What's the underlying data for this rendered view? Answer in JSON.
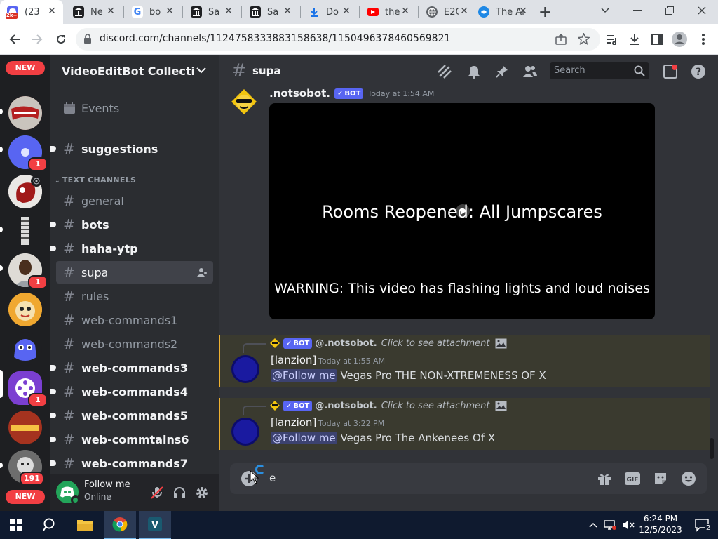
{
  "browser": {
    "tabs": [
      {
        "icon": "discord-icon",
        "title": "(23",
        "badge": "2k+",
        "active": true
      },
      {
        "icon": "museum-icon",
        "title": "Ne"
      },
      {
        "icon": "google-icon",
        "title": "bo"
      },
      {
        "icon": "museum-icon",
        "title": "Sa"
      },
      {
        "icon": "museum-icon",
        "title": "Sa"
      },
      {
        "icon": "download-icon",
        "title": "Do"
      },
      {
        "icon": "youtube-icon",
        "title": "the"
      },
      {
        "icon": "globe-icon",
        "title": "E2C"
      },
      {
        "icon": "ankenees-icon",
        "title": "The An"
      }
    ],
    "new_tab_label": "+",
    "url": "discord.com/channels/1124758333883158638/1150496378460569821"
  },
  "guilds": {
    "new_label": "NEW",
    "items": [
      {
        "name": "guild-calamity",
        "badge": ""
      },
      {
        "name": "guild-blue-circle",
        "badge": "1"
      },
      {
        "name": "guild-red-blob",
        "badge": ""
      },
      {
        "name": "guild-striped",
        "badge": ""
      },
      {
        "name": "guild-person",
        "badge": "1"
      },
      {
        "name": "guild-cartoon",
        "badge": ""
      },
      {
        "name": "guild-blue-alien",
        "badge": ""
      },
      {
        "name": "guild-film-reel",
        "badge": "1"
      },
      {
        "name": "guild-skoombs",
        "badge": ""
      },
      {
        "name": "guild-grey-face",
        "badge": "191"
      }
    ]
  },
  "sidebar": {
    "server_name": "VideoEditBot Collection ...",
    "events_label": "Events",
    "category": "TEXT CHANNELS",
    "channels": [
      {
        "name": "suggestions",
        "state": "unread"
      },
      {
        "name": "general",
        "state": "read"
      },
      {
        "name": "bots",
        "state": "unread"
      },
      {
        "name": "haha-ytp",
        "state": "unread"
      },
      {
        "name": "supa",
        "state": "active"
      },
      {
        "name": "rules",
        "state": "read"
      },
      {
        "name": "web-commands1",
        "state": "read"
      },
      {
        "name": "web-commands2",
        "state": "read"
      },
      {
        "name": "web-commands3",
        "state": "unread"
      },
      {
        "name": "web-commands4",
        "state": "unread"
      },
      {
        "name": "web-commands5",
        "state": "unread"
      },
      {
        "name": "web-commtains6",
        "state": "unread"
      },
      {
        "name": "web-commands7",
        "state": "unread"
      }
    ],
    "user": {
      "name": "Follow me",
      "status": "Online"
    }
  },
  "chat": {
    "channel": "supa",
    "search_placeholder": "Search",
    "bot_badge": "BOT",
    "message": {
      "author": ".notsobot.",
      "timestamp": "Today at 1:54 AM",
      "video": {
        "title": "Rooms Reopened: All Jumpscares",
        "warning": "WARNING: This video has flashing lights and loud noises"
      }
    },
    "replies": [
      {
        "reply_to": "@.notsobot.",
        "reply_hint": "Click to see attachment",
        "author": "[lanzion]",
        "timestamp": "Today at 1:55 AM",
        "mention": "@Follow me",
        "text": "Vegas Pro THE NON-XTREMENESS OF X"
      },
      {
        "reply_to": "@.notsobot.",
        "reply_hint": "Click to see attachment",
        "author": "[lanzion]",
        "timestamp": "Today at 3:22 PM",
        "mention": "@Follow me",
        "text": "Vegas Pro The Ankenees Of X"
      }
    ],
    "composer_text": "e"
  },
  "taskbar": {
    "time": "6:24 PM",
    "date": "12/5/2023",
    "notification_count": "2"
  },
  "colors": {
    "discord_accent": "#5865f2",
    "unread_badge": "#f23f43",
    "online": "#23a55a",
    "reply_highlight": "#f0b232"
  }
}
